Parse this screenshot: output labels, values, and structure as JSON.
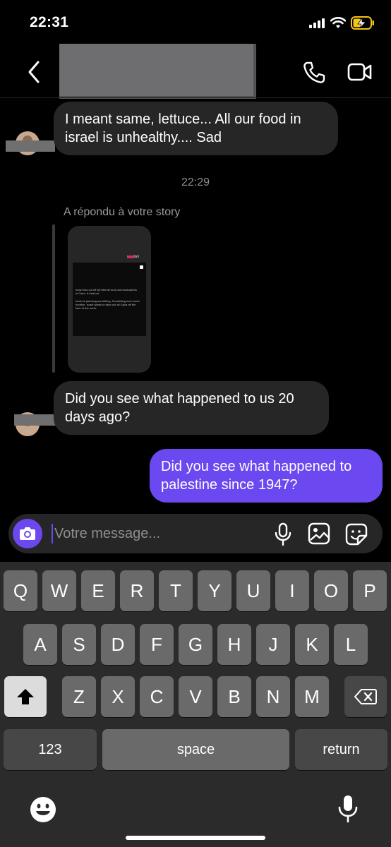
{
  "status_bar": {
    "time": "22:31"
  },
  "header": {
    "contact_name_redacted": true
  },
  "messages": [
    {
      "direction": "incoming",
      "text": "I meant same, lettuce... All our food in israel is unhealthy.... Sad"
    },
    {
      "direction": "incoming",
      "text": "Did you see what happened to us 20 days ago?"
    },
    {
      "direction": "outgoing",
      "text": "Did you see what happened to palestine since 1947?"
    }
  ],
  "timestamp": "22:29",
  "story_reply": {
    "label": "A répondu à votre story",
    "story_text_1": "Israel has cut off all Internet and communications in Gaza. A total cut.",
    "story_text_2": "Israel is planning something. Something even more horrible. Israel wants to wipe out all Gaza off the face of the earth.",
    "story_user": "ya.allah"
  },
  "composer": {
    "placeholder": "Votre message..."
  },
  "keyboard": {
    "row1": [
      "Q",
      "W",
      "E",
      "R",
      "T",
      "Y",
      "U",
      "I",
      "O",
      "P"
    ],
    "row2": [
      "A",
      "S",
      "D",
      "F",
      "G",
      "H",
      "J",
      "K",
      "L"
    ],
    "row3": [
      "Z",
      "X",
      "C",
      "V",
      "B",
      "N",
      "M"
    ],
    "numbers_label": "123",
    "space_label": "space",
    "return_label": "return"
  },
  "colors": {
    "accent": "#6b48ef",
    "bubble_in": "#262626",
    "background": "#000000"
  }
}
